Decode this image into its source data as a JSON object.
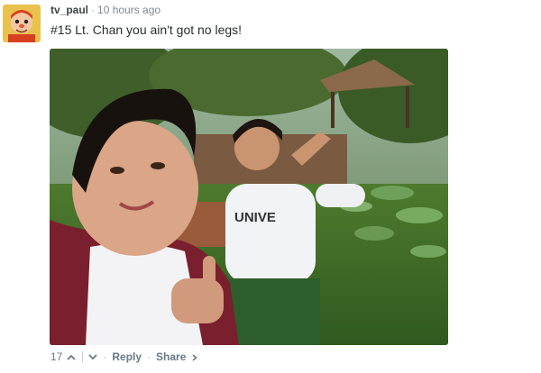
{
  "comment": {
    "author": "tv_paul",
    "separator": "·",
    "timestamp": "10 hours ago",
    "text": "#15 Lt. Chan you ain't got no legs!",
    "avatar_icon": "cartoon-avatar",
    "media_image": "selfie-photo",
    "footer": {
      "upvote_count": "17",
      "upvote_icon": "chevron-up-icon",
      "downvote_icon": "chevron-down-icon",
      "dot": "·",
      "reply_label": "Reply",
      "share_label": "Share",
      "share_icon": "chevron-right-icon"
    }
  }
}
